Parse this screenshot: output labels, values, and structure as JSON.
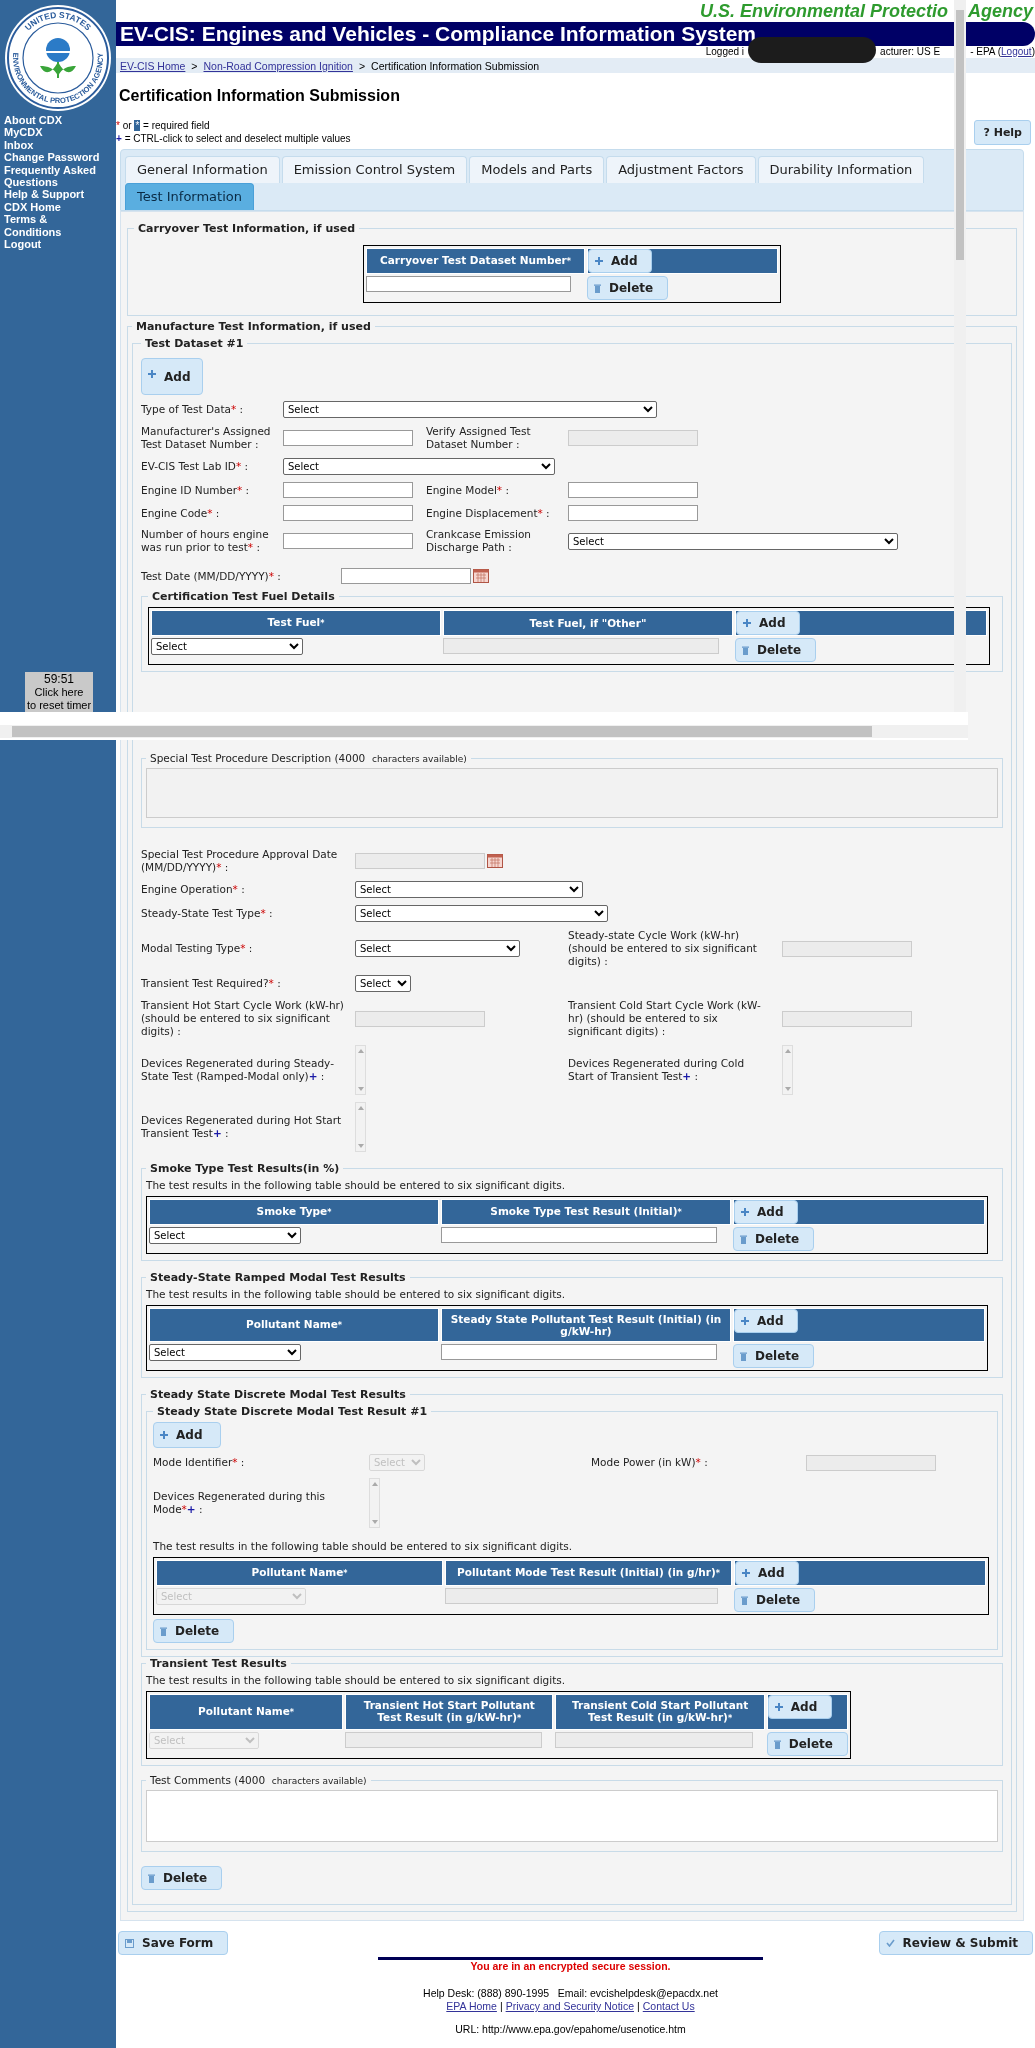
{
  "agency": {
    "left": "U.S. Environmental Protectio",
    "right": "Agency",
    "seal_top": "UNITED STATES",
    "seal_bottom": "ENVIRONMENTAL PROTECTION AGENCY"
  },
  "app_title": "EV-CIS: Engines and Vehicles - Compliance Information System",
  "login": {
    "prefix": "Logged i",
    "middle": "acturer: US E",
    "suffix": "- EPA (",
    "link": "Logout",
    "close": ")"
  },
  "breadcrumb": {
    "separator": ">",
    "items": [
      {
        "text": "EV-CIS Home",
        "link": true
      },
      {
        "text": "Non-Road Compression Ignition",
        "link": true
      },
      {
        "text": "Certification Information Submission",
        "link": false
      }
    ]
  },
  "sidebar": {
    "links": [
      "About CDX",
      "MyCDX",
      "Inbox",
      "Change Password",
      "Frequently Asked Questions",
      "Help & Support",
      "CDX Home",
      "Terms & Conditions",
      "Logout"
    ]
  },
  "timer": {
    "time": "59:51",
    "line1": "Click here",
    "line2": "to reset timer"
  },
  "page_title": "Certification Information Submission",
  "legend": {
    "req_a": "*",
    "or": "or",
    "req_b": "*",
    "req_text": "= required field",
    "multi": "+",
    "multi_text": "= CTRL-click to select and deselect multiple values"
  },
  "help_button": {
    "mark": "?",
    "label": "Help"
  },
  "tabs": [
    {
      "label": "General Information",
      "selected": false
    },
    {
      "label": "Emission Control System",
      "selected": false
    },
    {
      "label": "Models and Parts",
      "selected": false
    },
    {
      "label": "Adjustment Factors",
      "selected": false
    },
    {
      "label": "Durability Information",
      "selected": false
    },
    {
      "label": "Test Information",
      "selected": true
    }
  ],
  "carryover": {
    "title": "Carryover Test Information, if used",
    "table": {
      "columns": [
        {
          "label": "Carryover Test Dataset Number",
          "req": "*"
        }
      ],
      "row": [
        {
          "kind": "text",
          "disabled": false
        }
      ],
      "add": "Add",
      "delete": "Delete"
    }
  },
  "manufacture": {
    "title": "Manufacture Test Information, if used",
    "dataset": {
      "title": "Test Dataset #1",
      "add": "Add",
      "rows": [
        [
          {
            "label": "Type of Test Data",
            "req": "*",
            "tail": ":",
            "control": {
              "kind": "select",
              "value": "Select",
              "disabled": false
            }
          }
        ],
        [
          {
            "label": "Manufacturer's Assigned Test Dataset Number",
            "tail": ":",
            "control": {
              "kind": "text",
              "disabled": false
            }
          },
          {
            "label": "Verify Assigned Test Dataset Number",
            "tail": ":",
            "control": {
              "kind": "text",
              "disabled": true
            }
          }
        ],
        [
          {
            "label": "EV-CIS Test Lab ID",
            "req": "*",
            "tail": ":",
            "control": {
              "kind": "select",
              "value": "Select",
              "disabled": false
            }
          }
        ],
        [
          {
            "label": "Engine ID Number",
            "req": "*",
            "tail": ":",
            "control": {
              "kind": "text",
              "disabled": false
            }
          },
          {
            "label": "Engine Model",
            "req": "*",
            "tail": ":",
            "control": {
              "kind": "text",
              "disabled": false
            }
          }
        ],
        [
          {
            "label": "Engine Code",
            "req": "*",
            "tail": ":",
            "control": {
              "kind": "text",
              "disabled": false
            }
          },
          {
            "label": "Engine Displacement",
            "req": "*",
            "tail": ":",
            "control": {
              "kind": "text",
              "disabled": false
            }
          }
        ],
        [
          {
            "label": "Number of hours engine was run prior to test",
            "req": "*",
            "tail": ":",
            "control": {
              "kind": "text",
              "disabled": false
            }
          },
          {
            "label": "Crankcase Emission Discharge Path",
            "tail": ":",
            "control": {
              "kind": "select",
              "value": "Select",
              "disabled": false
            }
          }
        ]
      ],
      "test_date": {
        "label": "Test Date (MM/DD/YYYY)",
        "req": "*",
        "tail": ":",
        "control": {
          "kind": "date",
          "disabled": false
        }
      },
      "fuel": {
        "title": "Certification Test Fuel Details",
        "table": {
          "columns": [
            {
              "label": "Test Fuel",
              "req": "*"
            },
            {
              "label": "Test Fuel, if \"Other\""
            }
          ],
          "row": [
            {
              "kind": "select",
              "value": "Select",
              "disabled": false
            },
            {
              "kind": "text",
              "disabled": true
            }
          ],
          "add": "Add",
          "delete": "Delete"
        }
      }
    },
    "description": {
      "title": "Special Test Procedure Description",
      "count": "(4000",
      "count_tail": "characters available)",
      "disabled": true
    },
    "rows": [
      [
        {
          "label": "Special Test Procedure Approval Date (MM/DD/YYYY)",
          "req": "*",
          "tail": ":",
          "control": {
            "kind": "date",
            "disabled": true
          }
        }
      ],
      [
        {
          "label": "Engine Operation",
          "req": "*",
          "tail": ":",
          "control": {
            "kind": "select",
            "value": "Select",
            "disabled": false
          }
        }
      ],
      [
        {
          "label": "Steady-State Test Type",
          "req": "*",
          "tail": ":",
          "control": {
            "kind": "select",
            "value": "Select",
            "disabled": false
          }
        }
      ],
      [
        {
          "label": "Modal Testing Type",
          "req": "*",
          "tail": ":",
          "control": {
            "kind": "select",
            "value": "Select",
            "disabled": false
          }
        },
        {
          "label": "Steady-state Cycle Work (kW-hr) (should be entered to six significant digits)",
          "tail": ":",
          "control": {
            "kind": "text",
            "disabled": true
          }
        }
      ],
      [
        {
          "label": "Transient Test Required?",
          "req": "*",
          "tail": ":",
          "control": {
            "kind": "select",
            "value": "Select",
            "disabled": false
          }
        }
      ],
      [
        {
          "label": "Transient Hot Start Cycle Work (kW-hr) (should be entered to six significant digits)",
          "tail": ":",
          "control": {
            "kind": "text",
            "disabled": true
          }
        },
        {
          "label": "Transient Cold Start Cycle Work (kW-hr) (should be entered to six significant digits)",
          "tail": ":",
          "control": {
            "kind": "text",
            "disabled": true
          }
        }
      ],
      [
        {
          "label": "Devices Regenerated during Steady-State Test (Ramped-Modal only)",
          "multi": "+",
          "tail": ":",
          "control": {
            "kind": "list",
            "disabled": true
          }
        },
        {
          "label": "Devices Regenerated during Cold Start of Transient Test",
          "multi": "+",
          "tail": ":",
          "control": {
            "kind": "list",
            "disabled": true
          }
        }
      ],
      [
        {
          "label": "Devices Regenerated during Hot Start Transient Test",
          "multi": "+",
          "tail": ":",
          "control": {
            "kind": "list",
            "disabled": true
          }
        }
      ]
    ],
    "smoke": {
      "title": "Smoke Type Test Results(in %)",
      "note": "The test results in the following table should be entered to six significant digits.",
      "table": {
        "columns": [
          {
            "label": "Smoke Type",
            "req": "*"
          },
          {
            "label": "Smoke Type Test Result (Initial)",
            "req": "*"
          }
        ],
        "row": [
          {
            "kind": "select",
            "value": "Select",
            "disabled": false
          },
          {
            "kind": "text",
            "disabled": false
          }
        ],
        "add": "Add",
        "delete": "Delete"
      }
    },
    "ramped": {
      "title": "Steady-State Ramped Modal Test Results",
      "note": "The test results in the following table should be entered to six significant digits.",
      "table": {
        "columns": [
          {
            "label": "Pollutant Name",
            "req": "*"
          },
          {
            "label": "Steady State Pollutant Test Result (Initial) (in g/kW-hr)"
          }
        ],
        "row": [
          {
            "kind": "select",
            "value": "Select",
            "disabled": false
          },
          {
            "kind": "text",
            "disabled": false
          }
        ],
        "add": "Add",
        "delete": "Delete"
      }
    },
    "discrete": {
      "title": "Steady State Discrete Modal Test Results",
      "result": {
        "title": "Steady State Discrete Modal Test Result #1",
        "add": "Add",
        "rows": [
          [
            {
              "label": "Mode Identifier",
              "req": "*",
              "tail": ":",
              "control": {
                "kind": "select",
                "value": "Select",
                "disabled": true
              }
            },
            {
              "label": "Mode Power (in kW)",
              "req": "*",
              "tail": ":",
              "control": {
                "kind": "text",
                "disabled": true
              }
            }
          ],
          [
            {
              "label": "Devices Regenerated during this Mode",
              "req": "*",
              "multi": "+",
              "tail": ":",
              "control": {
                "kind": "list",
                "disabled": true
              }
            }
          ]
        ],
        "note": "The test results in the following table should be entered to six significant digits.",
        "table": {
          "columns": [
            {
              "label": "Pollutant Name",
              "req": "*"
            },
            {
              "label": "Pollutant Mode Test Result (Initial) (in g/hr)",
              "req": "*"
            }
          ],
          "row": [
            {
              "kind": "select",
              "value": "Select",
              "disabled": true
            },
            {
              "kind": "text",
              "disabled": true
            }
          ],
          "add": "Add",
          "delete": "Delete"
        },
        "delete": "Delete"
      }
    },
    "transient": {
      "title": "Transient Test Results",
      "note": "The test results in the following table should be entered to six significant digits.",
      "table": {
        "columns": [
          {
            "label": "Pollutant Name",
            "req": "*"
          },
          {
            "label": "Transient Hot Start Pollutant Test Result (in g/kW-hr)",
            "req": "*"
          },
          {
            "label": "Transient Cold Start Pollutant Test Result (in g/kW-hr)",
            "req": "*"
          }
        ],
        "row": [
          {
            "kind": "select",
            "value": "Select",
            "disabled": true
          },
          {
            "kind": "text",
            "disabled": true
          },
          {
            "kind": "text",
            "disabled": true
          }
        ],
        "add": "Add",
        "delete": "Delete"
      }
    },
    "comments": {
      "title": "Test Comments",
      "count": "(4000",
      "count_tail": "characters available)",
      "disabled": false
    },
    "delete": "Delete"
  },
  "actions": {
    "save": "Save Form",
    "submit": "Review & Submit"
  },
  "footer": {
    "secure": "You are in an encrypted secure session.",
    "helpdesk": "Help Desk: (888) 890-1995   Email: evcishelpdesk@epacdx.net",
    "links": [
      "EPA Home",
      "Privacy and Security Notice",
      "Contact Us"
    ],
    "separator": "|",
    "url": "URL: http://www.epa.gov/epahome/usenotice.htm"
  }
}
